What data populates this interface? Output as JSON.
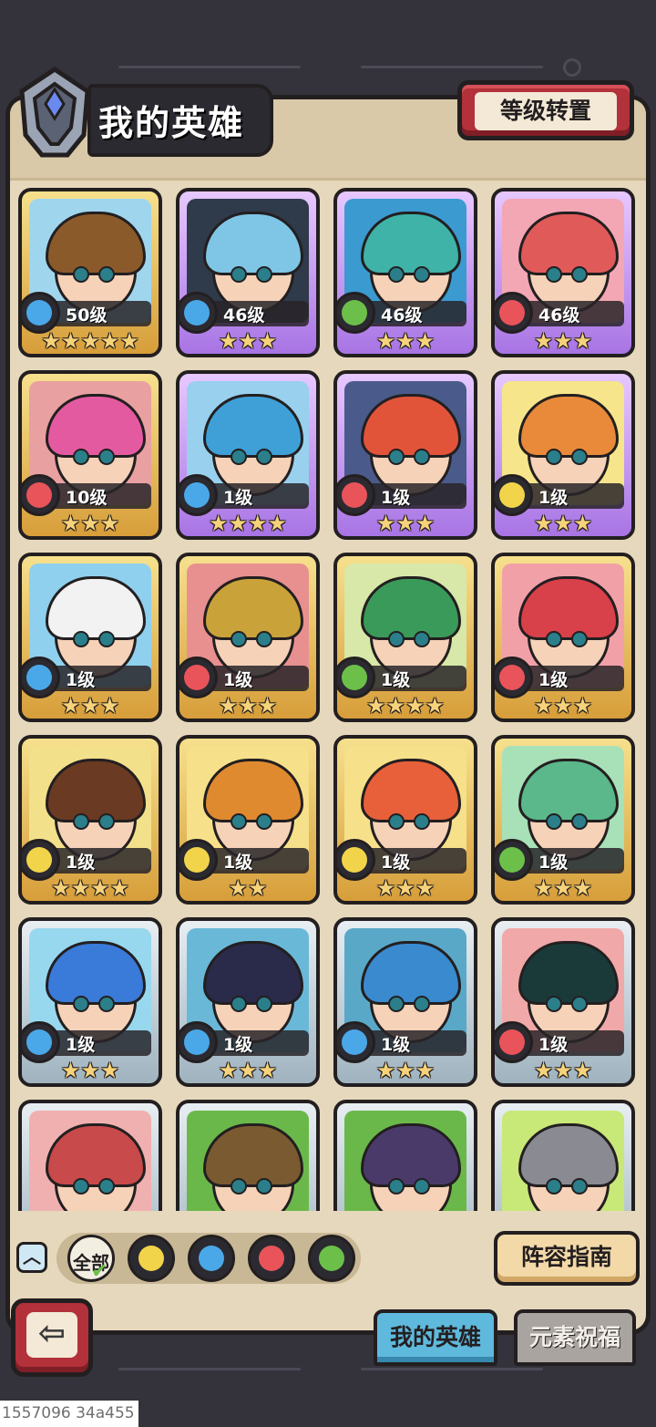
{
  "header": {
    "title": "我的英雄",
    "reset_button": "等级转置"
  },
  "heroes": [
    {
      "level": "50级",
      "element": "water",
      "stars": "★★★★★",
      "frame": "gold",
      "hair": "#8b5a2b",
      "bg": "#9fd6ee"
    },
    {
      "level": "46级",
      "element": "water",
      "stars": "★★★",
      "frame": "purple",
      "hair": "#7fc6e6",
      "bg": "#2f3a4a"
    },
    {
      "level": "46级",
      "element": "wind",
      "stars": "★★★",
      "frame": "purple",
      "hair": "#3fb3a8",
      "bg": "#3b9ad0"
    },
    {
      "level": "46级",
      "element": "fire",
      "stars": "★★★",
      "frame": "purple",
      "hair": "#e05a5a",
      "bg": "#f3a6b4"
    },
    {
      "level": "10级",
      "element": "fire",
      "stars": "★★★",
      "frame": "gold",
      "hair": "#e45aa0",
      "bg": "#e8a0a0"
    },
    {
      "level": "1级",
      "element": "water",
      "stars": "★★★★",
      "frame": "purple",
      "hair": "#3fa0d8",
      "bg": "#98d0ee"
    },
    {
      "level": "1级",
      "element": "fire",
      "stars": "★★★",
      "frame": "purple",
      "hair": "#e2543a",
      "bg": "#4a5a8a"
    },
    {
      "level": "1级",
      "element": "earth",
      "stars": "★★★",
      "frame": "purple",
      "hair": "#e88a3a",
      "bg": "#f6e58a"
    },
    {
      "level": "1级",
      "element": "water",
      "stars": "★★★",
      "frame": "gold",
      "hair": "#f2f2f2",
      "bg": "#8fd0ee"
    },
    {
      "level": "1级",
      "element": "fire",
      "stars": "★★★",
      "frame": "gold",
      "hair": "#c9a23a",
      "bg": "#e89090"
    },
    {
      "level": "1级",
      "element": "wind",
      "stars": "★★★★",
      "frame": "gold",
      "hair": "#3a9a5a",
      "bg": "#d8e8a8"
    },
    {
      "level": "1级",
      "element": "fire",
      "stars": "★★★",
      "frame": "gold",
      "hair": "#d8404a",
      "bg": "#f2a0a8"
    },
    {
      "level": "1级",
      "element": "earth",
      "stars": "★★★★",
      "frame": "gold",
      "hair": "#6a3a22",
      "bg": "#f3e08a"
    },
    {
      "level": "1级",
      "element": "earth",
      "stars": "★★",
      "frame": "gold",
      "hair": "#e08a30",
      "bg": "#f6e08a"
    },
    {
      "level": "1级",
      "element": "earth",
      "stars": "★★★",
      "frame": "gold",
      "hair": "#e8603a",
      "bg": "#f6e08a"
    },
    {
      "level": "1级",
      "element": "wind",
      "stars": "★★★",
      "frame": "gold",
      "hair": "#5ab88a",
      "bg": "#a8e0b8"
    },
    {
      "level": "1级",
      "element": "water",
      "stars": "★★★",
      "frame": "silver",
      "hair": "#3a7ad8",
      "bg": "#98d8ee"
    },
    {
      "level": "1级",
      "element": "water",
      "stars": "★★★",
      "frame": "silver",
      "hair": "#2a2a4a",
      "bg": "#6ab8d8"
    },
    {
      "level": "1级",
      "element": "water",
      "stars": "★★★",
      "frame": "silver",
      "hair": "#3a8ad0",
      "bg": "#5aa8c8"
    },
    {
      "level": "1级",
      "element": "fire",
      "stars": "★★★",
      "frame": "silver",
      "hair": "#1a3a3a",
      "bg": "#f0a8a8"
    },
    {
      "level": "",
      "element": "",
      "stars": "",
      "frame": "silver",
      "hair": "#c84a4a",
      "bg": "#f0b0b0"
    },
    {
      "level": "",
      "element": "",
      "stars": "",
      "frame": "silver",
      "hair": "#7a5a30",
      "bg": "#6ab84a"
    },
    {
      "level": "",
      "element": "",
      "stars": "",
      "frame": "silver",
      "hair": "#4a3a6a",
      "bg": "#6ab84a"
    },
    {
      "level": "",
      "element": "",
      "stars": "",
      "frame": "silver",
      "hair": "#8a8a92",
      "bg": "#c8e878"
    }
  ],
  "filters": {
    "collapse_icon": "chevron-up-icon",
    "all_label": "全部",
    "items": [
      "earth",
      "water",
      "fire",
      "wind"
    ]
  },
  "guide_button": "阵容指南",
  "tabs": {
    "active": "我的英雄",
    "inactive": "元素祝福"
  },
  "back_icon": "back-arrow-icon",
  "footer_id": "1557096 34a455",
  "colors": {
    "water": "#4aa8e8",
    "fire": "#e8545a",
    "wind": "#6cc04a",
    "earth": "#f1d44a"
  }
}
